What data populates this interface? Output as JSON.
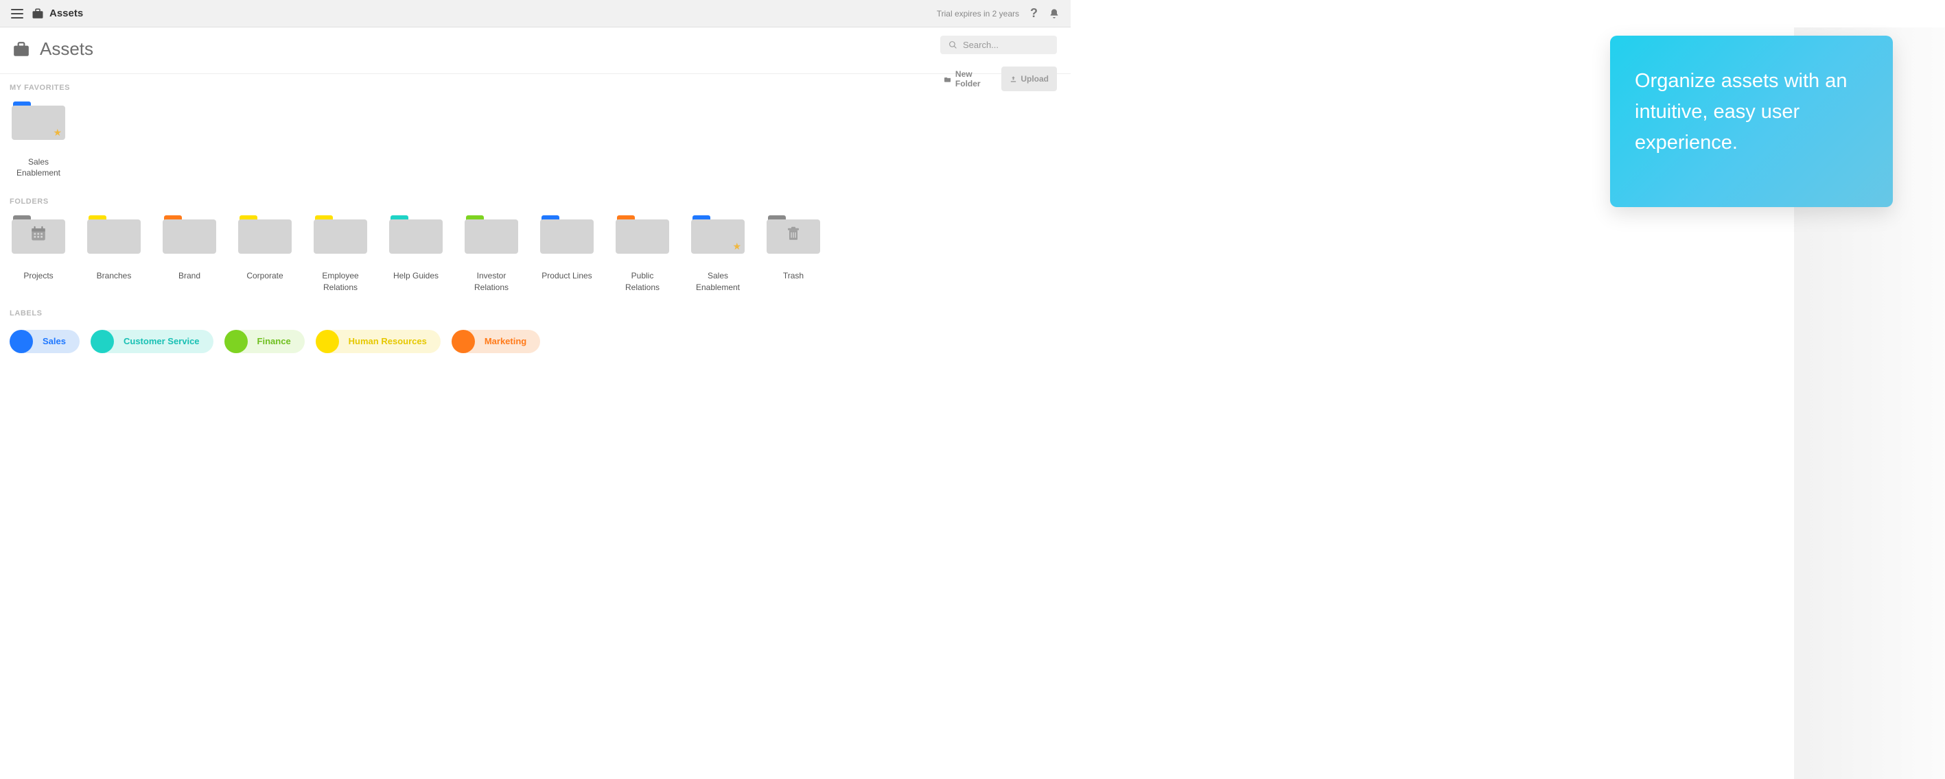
{
  "appbar": {
    "title": "Assets",
    "trial_text": "Trial expires in 2 years"
  },
  "page": {
    "title": "Assets"
  },
  "search": {
    "placeholder": "Search..."
  },
  "actions": {
    "new_folder": "New Folder",
    "upload": "Upload"
  },
  "sections": {
    "favorites_title": "MY FAVORITES",
    "folders_title": "FOLDERS",
    "labels_title": "LABELS"
  },
  "favorites": [
    {
      "name": "Sales Enablement",
      "tab_color": "#1f78ff",
      "starred": true
    }
  ],
  "folders": [
    {
      "name": "Projects",
      "tab_color": "#8a8a8a",
      "overlay": "calendar"
    },
    {
      "name": "Branches",
      "tab_color": "#ffe000"
    },
    {
      "name": "Brand",
      "tab_color": "#ff7a1a"
    },
    {
      "name": "Corporate",
      "tab_color": "#ffe000"
    },
    {
      "name": "Employee Relations",
      "tab_color": "#ffe000"
    },
    {
      "name": "Help Guides",
      "tab_color": "#1fd3c6"
    },
    {
      "name": "Investor Relations",
      "tab_color": "#7ed321"
    },
    {
      "name": "Product Lines",
      "tab_color": "#1f78ff"
    },
    {
      "name": "Public Relations",
      "tab_color": "#ff7a1a"
    },
    {
      "name": "Sales Enablement",
      "tab_color": "#1f78ff",
      "starred": true
    },
    {
      "name": "Trash",
      "tab_color": "#8a8a8a",
      "overlay": "trash"
    }
  ],
  "labels": [
    {
      "name": "Sales",
      "color": "#1f78ff",
      "bg": "#d6e6fb",
      "text": "#1f78ff"
    },
    {
      "name": "Customer Service",
      "color": "#1fd3c6",
      "bg": "#d8f7f3",
      "text": "#19c0b4"
    },
    {
      "name": "Finance",
      "color": "#7ed321",
      "bg": "#ecf9df",
      "text": "#6fbf1f"
    },
    {
      "name": "Human Resources",
      "color": "#ffe000",
      "bg": "#fdf7d6",
      "text": "#e6c800"
    },
    {
      "name": "Marketing",
      "color": "#ff7a1a",
      "bg": "#fde6d4",
      "text": "#ff7a1a"
    }
  ],
  "callout": {
    "text": "Organize assets with an intuitive, easy user experience."
  }
}
